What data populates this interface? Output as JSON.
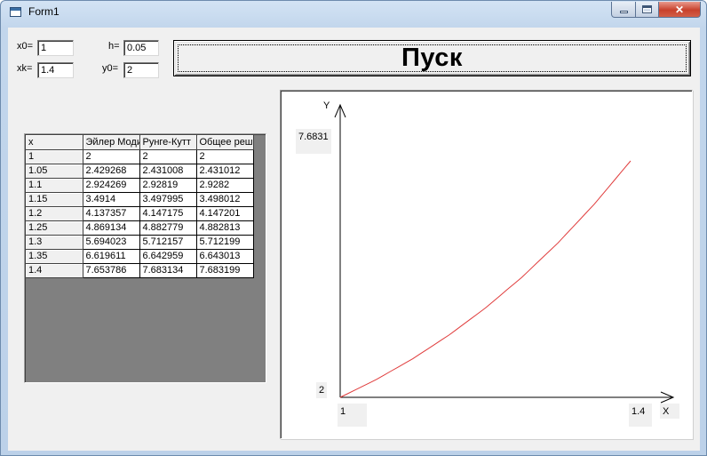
{
  "window": {
    "title": "Form1"
  },
  "inputs": {
    "x0": {
      "label": "x0=",
      "value": "1"
    },
    "xk": {
      "label": "xk=",
      "value": "1.4"
    },
    "h": {
      "label": "h=",
      "value": "0.05"
    },
    "y0": {
      "label": "y0=",
      "value": "2"
    }
  },
  "start_button": {
    "label": "Пуск"
  },
  "table": {
    "headers": [
      "x",
      "Эйлер Моди",
      "Рунге-Кутт",
      "Общее реш"
    ],
    "rows": [
      [
        "1",
        "2",
        "2",
        "2"
      ],
      [
        "1.05",
        "2.429268",
        "2.431008",
        "2.431012"
      ],
      [
        "1.1",
        "2.924269",
        "2.92819",
        "2.9282"
      ],
      [
        "1.15",
        "3.4914",
        "3.497995",
        "3.498012"
      ],
      [
        "1.2",
        "4.137357",
        "4.147175",
        "4.147201"
      ],
      [
        "1.25",
        "4.869134",
        "4.882779",
        "4.882813"
      ],
      [
        "1.3",
        "5.694023",
        "5.712157",
        "5.712199"
      ],
      [
        "1.35",
        "6.619611",
        "6.642959",
        "6.643013"
      ],
      [
        "1.4",
        "7.653786",
        "7.683134",
        "7.683199"
      ]
    ]
  },
  "chart_data": {
    "type": "line",
    "xlabel": "X",
    "ylabel": "Y",
    "x_min_label": "1",
    "x_max_label": "1.4",
    "y_min_label": "2",
    "y_max_label": "7.6831",
    "xlim": [
      1,
      1.4
    ],
    "ylim": [
      2,
      7.6831
    ],
    "series": [
      {
        "color": "#e03c3c",
        "x": [
          1,
          1.05,
          1.1,
          1.15,
          1.2,
          1.25,
          1.3,
          1.35,
          1.4
        ],
        "y": [
          2,
          2.431008,
          2.92819,
          3.497995,
          4.147175,
          4.882779,
          5.712157,
          6.642959,
          7.683134
        ]
      }
    ]
  }
}
